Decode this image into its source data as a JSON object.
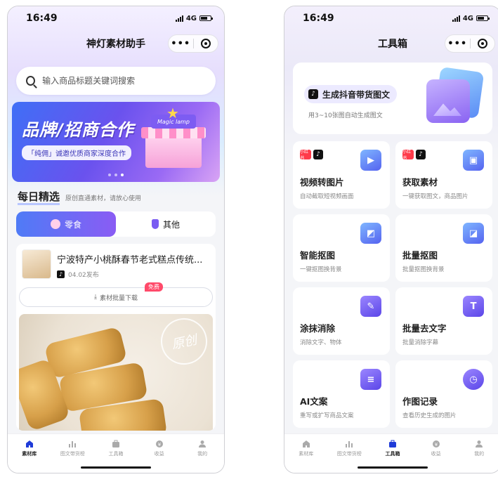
{
  "status": {
    "time": "16:49",
    "network": "4G"
  },
  "left": {
    "nav_title": "神灯素材助手",
    "capsule_dots": "•••",
    "search": {
      "placeholder": "输入商品标题关键词搜索"
    },
    "banner": {
      "title": "品牌/招商合作",
      "subtitle": "「纯佣」诚邀优质商家深度合作",
      "sign": "Magic lamp",
      "active_slide": 3,
      "slides": 3
    },
    "section": {
      "title": "每日精选",
      "desc": "原创直通素材，请放心使用"
    },
    "segments": [
      {
        "label": "零食",
        "icon": "snack-icon",
        "active": true
      },
      {
        "label": "其他",
        "icon": "other-icon",
        "active": false
      }
    ],
    "card": {
      "title": "宁波特产小桃酥春节老式糕点传统...",
      "date": "04.02发布",
      "download_label": "素材批量下载",
      "badge": "免费",
      "stamp": "原创"
    },
    "tabs": [
      {
        "label": "素材库",
        "icon": "home-icon",
        "active": true
      },
      {
        "label": "图文带货榜",
        "icon": "chart-icon",
        "active": false
      },
      {
        "label": "工具箱",
        "icon": "toolbox-icon",
        "active": false
      },
      {
        "label": "收益",
        "icon": "income-icon",
        "active": false
      },
      {
        "label": "我的",
        "icon": "user-icon",
        "active": false
      }
    ]
  },
  "right": {
    "nav_title": "工具箱",
    "capsule_dots": "•••",
    "hero": {
      "title": "生成抖音带货图文",
      "desc": "用3~10张图自动生成图文"
    },
    "tools": [
      {
        "name": "视频转图片",
        "desc": "自动截取短视频画面",
        "icon": "video-to-image-icon",
        "badges": true
      },
      {
        "name": "获取素材",
        "desc": "一键获取图文，商品图片",
        "icon": "get-material-icon",
        "badges": true
      },
      {
        "name": "智能抠图",
        "desc": "一键抠图换背景",
        "icon": "smart-cutout-icon",
        "badges": false
      },
      {
        "name": "批量抠图",
        "desc": "批量抠图换背景",
        "icon": "batch-cutout-icon",
        "badges": false
      },
      {
        "name": "涂抹消除",
        "desc": "消除文字、物体",
        "icon": "brush-erase-icon",
        "badges": false
      },
      {
        "name": "批量去文字",
        "desc": "批量消除字幕",
        "icon": "remove-text-icon",
        "badges": false
      },
      {
        "name": "AI文案",
        "desc": "重写或扩写商品文案",
        "icon": "ai-copy-icon",
        "badges": false
      },
      {
        "name": "作图记录",
        "desc": "查看历史生成的图片",
        "icon": "history-icon",
        "badges": false
      }
    ],
    "tabs": [
      {
        "label": "素材库",
        "icon": "home-icon",
        "active": false
      },
      {
        "label": "图文带货榜",
        "icon": "chart-icon",
        "active": false
      },
      {
        "label": "工具箱",
        "icon": "toolbox-icon",
        "active": true
      },
      {
        "label": "收益",
        "icon": "income-icon",
        "active": false
      },
      {
        "label": "我的",
        "icon": "user-icon",
        "active": false
      }
    ]
  },
  "badges": {
    "red_label": "小红书",
    "tiktok_glyph": "♪"
  },
  "colors": {
    "accent_start": "#4f7bf6",
    "accent_end": "#8a5cf4",
    "free_badge": "#ff4a6a"
  }
}
